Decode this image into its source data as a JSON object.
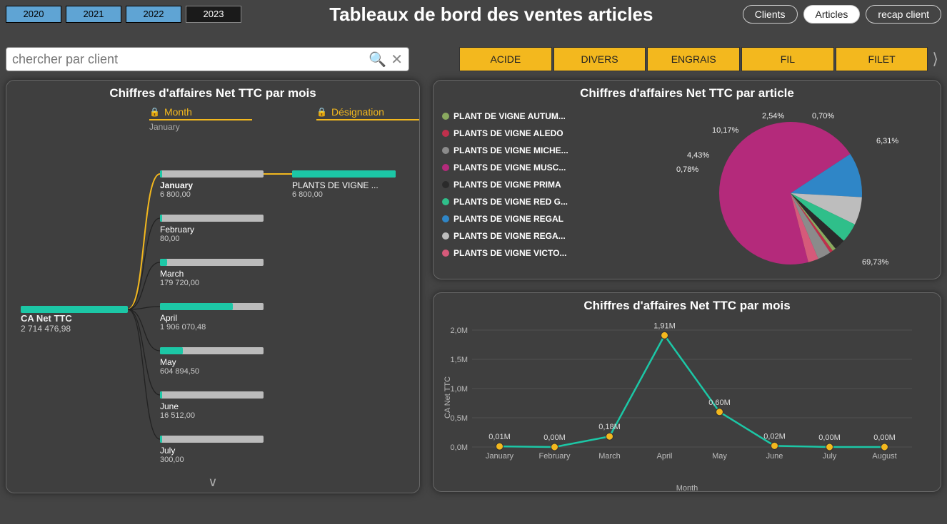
{
  "header": {
    "years": [
      "2020",
      "2021",
      "2022",
      "2023"
    ],
    "active_year_index": 3,
    "title": "Tableaux de bord des ventes articles",
    "tabs": [
      {
        "label": "Clients",
        "active": false
      },
      {
        "label": "Articles",
        "active": true
      },
      {
        "label": "recap client",
        "active": false
      }
    ]
  },
  "search": {
    "placeholder": "chercher par client"
  },
  "categories": [
    "ACIDE",
    "DIVERS",
    "ENGRAIS",
    "FIL",
    "FILET"
  ],
  "decomp": {
    "title": "Chiffres d'affaires Net TTC par mois",
    "col1": {
      "label": "Month",
      "sub": "January"
    },
    "col2": {
      "label": "Désignation",
      "sub": ""
    },
    "root": {
      "name": "CA Net TTC",
      "value": "2 714 476,98"
    },
    "months": [
      {
        "name": "January",
        "value": "6 800,00",
        "fill": 0.003,
        "selected": true
      },
      {
        "name": "February",
        "value": "80,00",
        "fill": 3e-05
      },
      {
        "name": "March",
        "value": "179 720,00",
        "fill": 0.066
      },
      {
        "name": "April",
        "value": "1 906 070,48",
        "fill": 0.702
      },
      {
        "name": "May",
        "value": "604 894,50",
        "fill": 0.223
      },
      {
        "name": "June",
        "value": "16 512,00",
        "fill": 0.006
      },
      {
        "name": "July",
        "value": "300,00",
        "fill": 0.0001
      }
    ],
    "detail": {
      "name": "PLANTS DE VIGNE ...",
      "value": "6 800,00"
    }
  },
  "pie": {
    "title": "Chiffres d'affaires Net TTC par article",
    "legend": [
      {
        "label": "PLANT DE VIGNE AUTUM...",
        "color": "#8aa95f"
      },
      {
        "label": "PLANTS DE VIGNE ALEDO",
        "color": "#c0304c"
      },
      {
        "label": "PLANTS DE VIGNE MICHE...",
        "color": "#8b8b8b"
      },
      {
        "label": "PLANTS DE VIGNE MUSC...",
        "color": "#b42a7b"
      },
      {
        "label": "PLANTS DE VIGNE PRIMA",
        "color": "#2a2a2a"
      },
      {
        "label": "PLANTS DE VIGNE RED G...",
        "color": "#2fbf8a"
      },
      {
        "label": "PLANTS DE VIGNE REGAL",
        "color": "#2f86c7"
      },
      {
        "label": "PLANTS DE VIGNE REGA...",
        "color": "#bdbdbd"
      },
      {
        "label": "PLANTS DE VIGNE VICTO...",
        "color": "#d65a7a"
      }
    ]
  },
  "line": {
    "title": "Chiffres d'affaires Net TTC par mois",
    "ylabel": "CA Net TTC",
    "xlabel": "Month"
  },
  "chart_data": [
    {
      "type": "bar",
      "title": "Chiffres d'affaires Net TTC par mois (decomposition tree)",
      "root_value": 2714476.98,
      "categories": [
        "January",
        "February",
        "March",
        "April",
        "May",
        "June",
        "July"
      ],
      "values": [
        6800.0,
        80.0,
        179720.0,
        1906070.48,
        604894.5,
        16512.0,
        300.0
      ],
      "selected": "January",
      "selected_breakdown": [
        {
          "label": "PLANTS DE VIGNE ...",
          "value": 6800.0
        }
      ],
      "ylabel": "CA Net TTC"
    },
    {
      "type": "pie",
      "title": "Chiffres d'affaires Net TTC par article",
      "series": [
        {
          "name": "PLANTS DE VIGNE MUSC...",
          "percent": 69.73,
          "color": "#b42a7b"
        },
        {
          "name": "PLANTS DE VIGNE REGAL",
          "percent": 10.17,
          "color": "#2f86c7"
        },
        {
          "name": "PLANTS DE VIGNE REGA...",
          "percent": 6.31,
          "color": "#bdbdbd"
        },
        {
          "name": "PLANTS DE VIGNE RED G...",
          "percent": 4.43,
          "color": "#2fbf8a"
        },
        {
          "name": "PLANTS DE VIGNE PRIMA",
          "percent": 2.54,
          "color": "#2a2a2a"
        },
        {
          "name": "PLANT DE VIGNE AUTUM...",
          "percent": 0.78,
          "color": "#8aa95f"
        },
        {
          "name": "PLANTS DE VIGNE ALEDO",
          "percent": 0.7,
          "color": "#c0304c"
        },
        {
          "name": "PLANTS DE VIGNE MICHE...",
          "percent": 3.0,
          "color": "#8b8b8b"
        },
        {
          "name": "PLANTS DE VIGNE VICTO...",
          "percent": 2.34,
          "color": "#d65a7a"
        }
      ],
      "labels_shown": [
        "10,17%",
        "2,54%",
        "0,70%",
        "6,31%",
        "4,43%",
        "0,78%",
        "69,73%"
      ]
    },
    {
      "type": "line",
      "title": "Chiffres d'affaires Net TTC par mois",
      "xlabel": "Month",
      "ylabel": "CA Net TTC",
      "categories": [
        "January",
        "February",
        "March",
        "April",
        "May",
        "June",
        "July",
        "August"
      ],
      "values_millions": [
        0.01,
        0.0,
        0.18,
        1.91,
        0.6,
        0.02,
        0.0,
        0.0
      ],
      "data_labels": [
        "0,01M",
        "0,00M",
        "0,18M",
        "1,91M",
        "0,60M",
        "0,02M",
        "0,00M",
        "0,00M"
      ],
      "ylim": [
        0,
        2.0
      ],
      "yticks": [
        "0,0M",
        "0,5M",
        "1,0M",
        "1,5M",
        "2,0M"
      ]
    }
  ]
}
